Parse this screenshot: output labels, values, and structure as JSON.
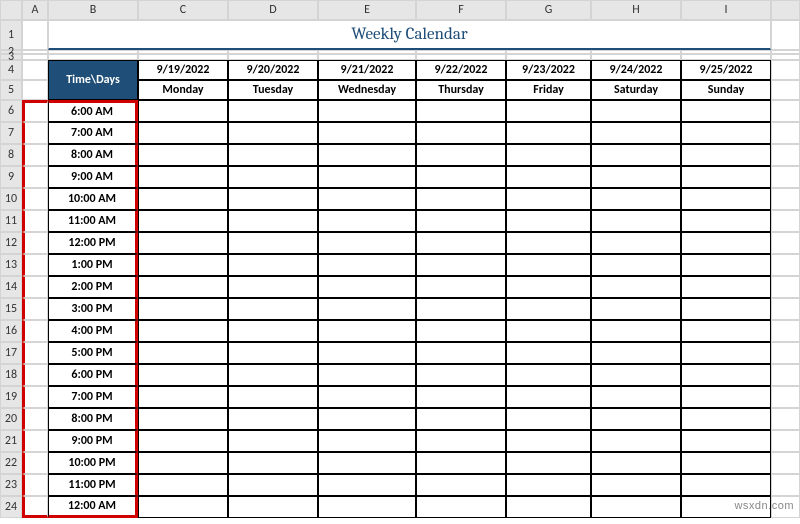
{
  "columns": [
    "A",
    "B",
    "C",
    "D",
    "E",
    "F",
    "G",
    "H",
    "I"
  ],
  "rows": [
    "1",
    "2",
    "3",
    "4",
    "5",
    "6",
    "7",
    "8",
    "9",
    "10",
    "11",
    "12",
    "13",
    "14",
    "15",
    "16",
    "17",
    "18",
    "19",
    "20",
    "21",
    "22",
    "23",
    "24"
  ],
  "title": "Weekly Calendar",
  "header_main": "Time\\Days",
  "dates": [
    "9/19/2022",
    "9/20/2022",
    "9/21/2022",
    "9/22/2022",
    "9/23/2022",
    "9/24/2022",
    "9/25/2022"
  ],
  "days": [
    "Monday",
    "Tuesday",
    "Wednesday",
    "Thursday",
    "Friday",
    "Saturday",
    "Sunday"
  ],
  "times": [
    "6:00 AM",
    "7:00 AM",
    "8:00 AM",
    "9:00 AM",
    "10:00 AM",
    "11:00 AM",
    "12:00 PM",
    "1:00 PM",
    "2:00 PM",
    "3:00 PM",
    "4:00 PM",
    "5:00 PM",
    "6:00 PM",
    "7:00 PM",
    "8:00 PM",
    "9:00 PM",
    "10:00 PM",
    "11:00 PM",
    "12:00 AM"
  ],
  "watermark": "wsxdn.com",
  "chart_data": {
    "type": "table",
    "title": "Weekly Calendar",
    "columns": [
      "Time\\Days",
      "9/19/2022 Monday",
      "9/20/2022 Tuesday",
      "9/21/2022 Wednesday",
      "9/22/2022 Thursday",
      "9/23/2022 Friday",
      "9/24/2022 Saturday",
      "9/25/2022 Sunday"
    ],
    "rows": [
      [
        "6:00 AM",
        "",
        "",
        "",
        "",
        "",
        "",
        ""
      ],
      [
        "7:00 AM",
        "",
        "",
        "",
        "",
        "",
        "",
        ""
      ],
      [
        "8:00 AM",
        "",
        "",
        "",
        "",
        "",
        "",
        ""
      ],
      [
        "9:00 AM",
        "",
        "",
        "",
        "",
        "",
        "",
        ""
      ],
      [
        "10:00 AM",
        "",
        "",
        "",
        "",
        "",
        "",
        ""
      ],
      [
        "11:00 AM",
        "",
        "",
        "",
        "",
        "",
        "",
        ""
      ],
      [
        "12:00 PM",
        "",
        "",
        "",
        "",
        "",
        "",
        ""
      ],
      [
        "1:00 PM",
        "",
        "",
        "",
        "",
        "",
        "",
        ""
      ],
      [
        "2:00 PM",
        "",
        "",
        "",
        "",
        "",
        "",
        ""
      ],
      [
        "3:00 PM",
        "",
        "",
        "",
        "",
        "",
        "",
        ""
      ],
      [
        "4:00 PM",
        "",
        "",
        "",
        "",
        "",
        "",
        ""
      ],
      [
        "5:00 PM",
        "",
        "",
        "",
        "",
        "",
        "",
        ""
      ],
      [
        "6:00 PM",
        "",
        "",
        "",
        "",
        "",
        "",
        ""
      ],
      [
        "7:00 PM",
        "",
        "",
        "",
        "",
        "",
        "",
        ""
      ],
      [
        "8:00 PM",
        "",
        "",
        "",
        "",
        "",
        "",
        ""
      ],
      [
        "9:00 PM",
        "",
        "",
        "",
        "",
        "",
        "",
        ""
      ],
      [
        "10:00 PM",
        "",
        "",
        "",
        "",
        "",
        "",
        ""
      ],
      [
        "11:00 PM",
        "",
        "",
        "",
        "",
        "",
        "",
        ""
      ],
      [
        "12:00 AM",
        "",
        "",
        "",
        "",
        "",
        "",
        ""
      ]
    ]
  }
}
